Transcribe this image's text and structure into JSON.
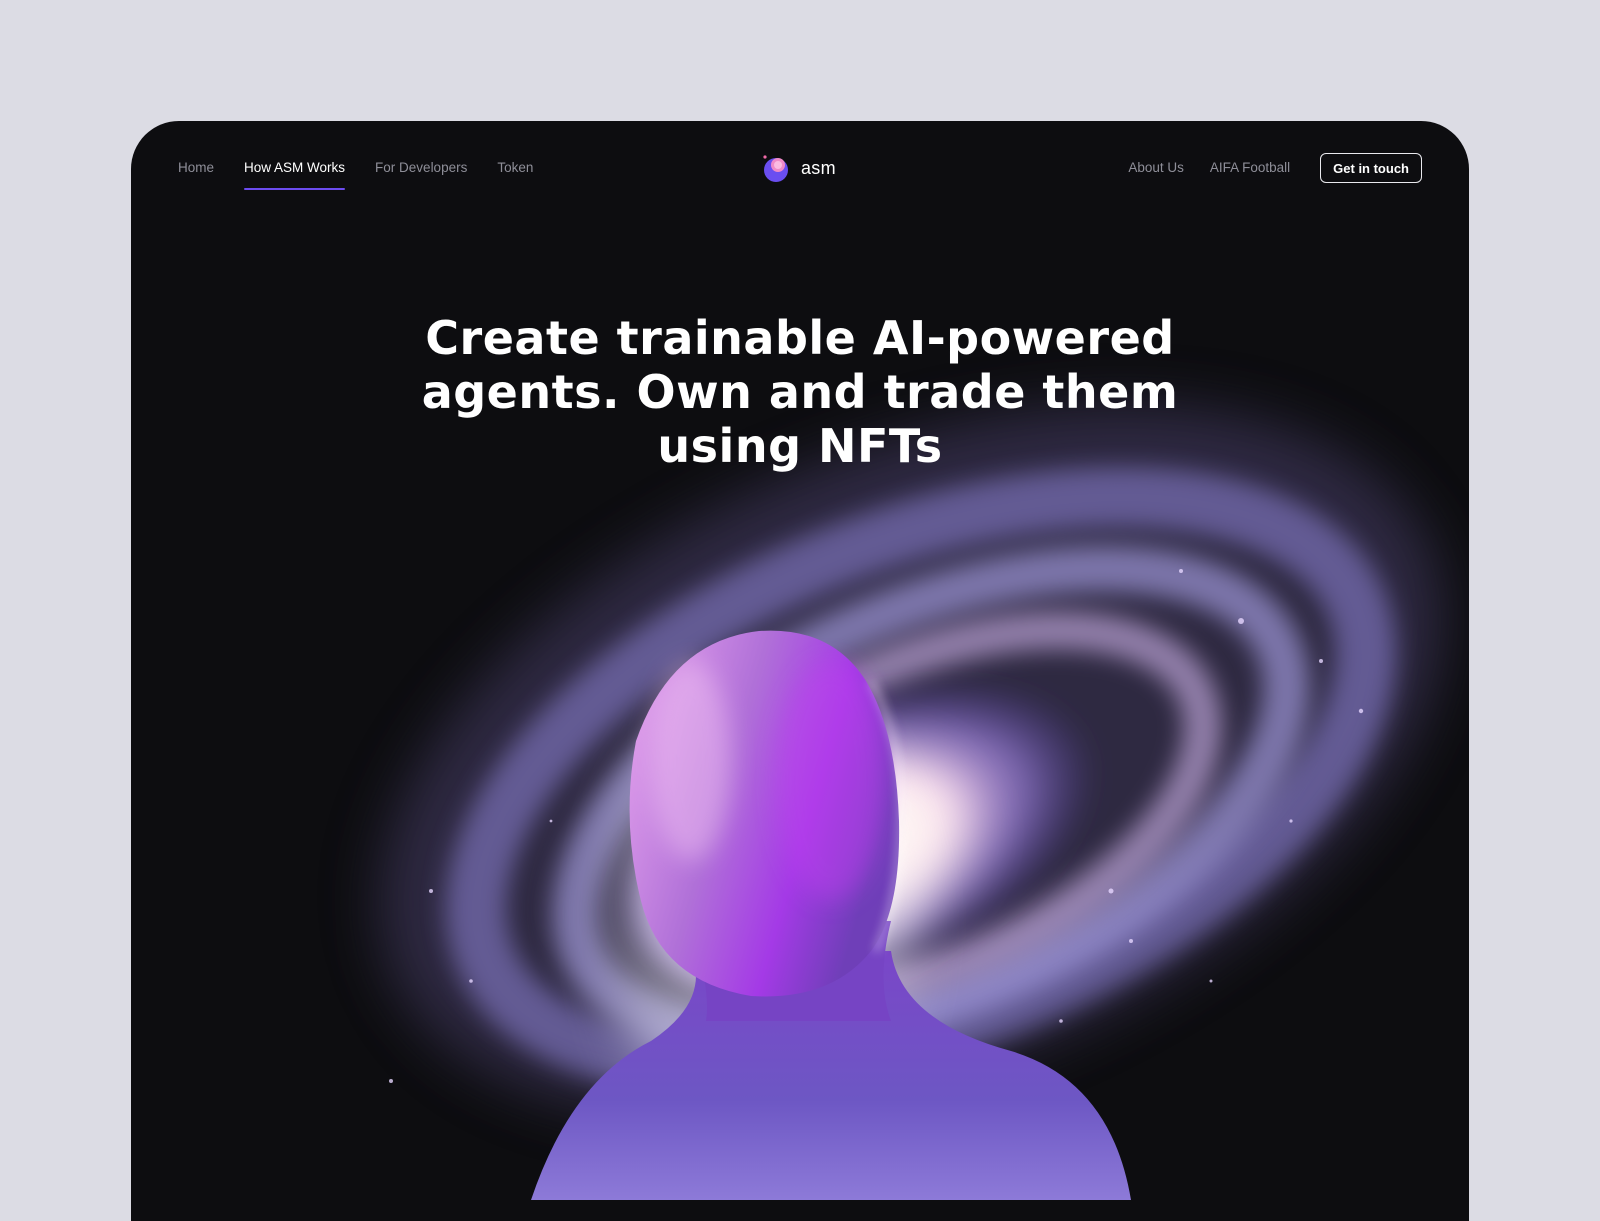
{
  "nav": {
    "left_links": [
      {
        "label": "Home",
        "active": false
      },
      {
        "label": "How ASM Works",
        "active": true
      },
      {
        "label": "For Developers",
        "active": false
      },
      {
        "label": "Token",
        "active": false
      }
    ],
    "brand": "asm",
    "right_links": [
      {
        "label": "About Us"
      },
      {
        "label": "AIFA Football"
      }
    ],
    "cta_label": "Get in touch"
  },
  "hero": {
    "headline": "Create trainable AI-powered agents. Own and trade them using NFTs"
  },
  "colors": {
    "page_background": "#dcdce4",
    "frame_background": "#0d0d10",
    "accent": "#6c4cf0",
    "nav_text": "#8e8e98"
  }
}
